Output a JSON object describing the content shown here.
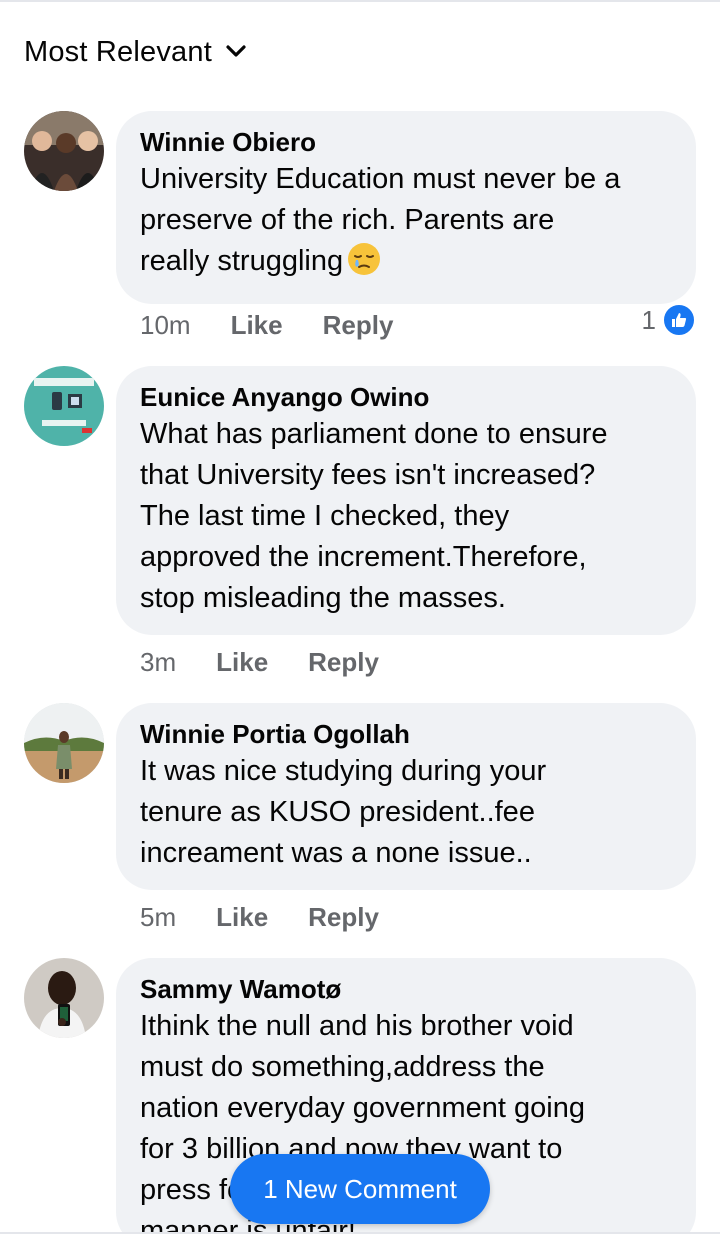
{
  "sort": {
    "label": "Most Relevant",
    "icon": "chevron-down-icon"
  },
  "comments": [
    {
      "author": "Winnie Obiero",
      "lines": [
        "University Education must never be a",
        "preserve of the rich. Parents are",
        "really struggling"
      ],
      "emoji": "sleepy-face-emoji",
      "time": "10m",
      "like_label": "Like",
      "reply_label": "Reply",
      "reaction_count": "1",
      "reaction_icon": "like-icon"
    },
    {
      "author": "Eunice Anyango Owino",
      "lines": [
        "What has parliament done to ensure",
        "that University fees isn't increased?",
        "The last time I checked, they",
        "approved the increment.Therefore,",
        "stop misleading the masses."
      ],
      "time": "3m",
      "like_label": "Like",
      "reply_label": "Reply"
    },
    {
      "author": "Winnie Portia Ogollah",
      "lines": [
        "It was nice studying during your",
        "tenure as KUSO president..fee",
        "increament was a none issue.."
      ],
      "time": "5m",
      "like_label": "Like",
      "reply_label": "Reply"
    },
    {
      "author": "Sammy Wamotø",
      "lines": [
        "Ithink the null and his brother void",
        "must do something,address the",
        "nation everyday government going",
        "for 3 billion and now they want to",
        "press for it in whichever",
        "manner is unfair!"
      ]
    }
  ],
  "new_comment_button": {
    "label": "1 New Comment"
  },
  "colors": {
    "accent": "#1877f2",
    "bubble": "#f0f2f5",
    "meta_text": "#65676b"
  }
}
